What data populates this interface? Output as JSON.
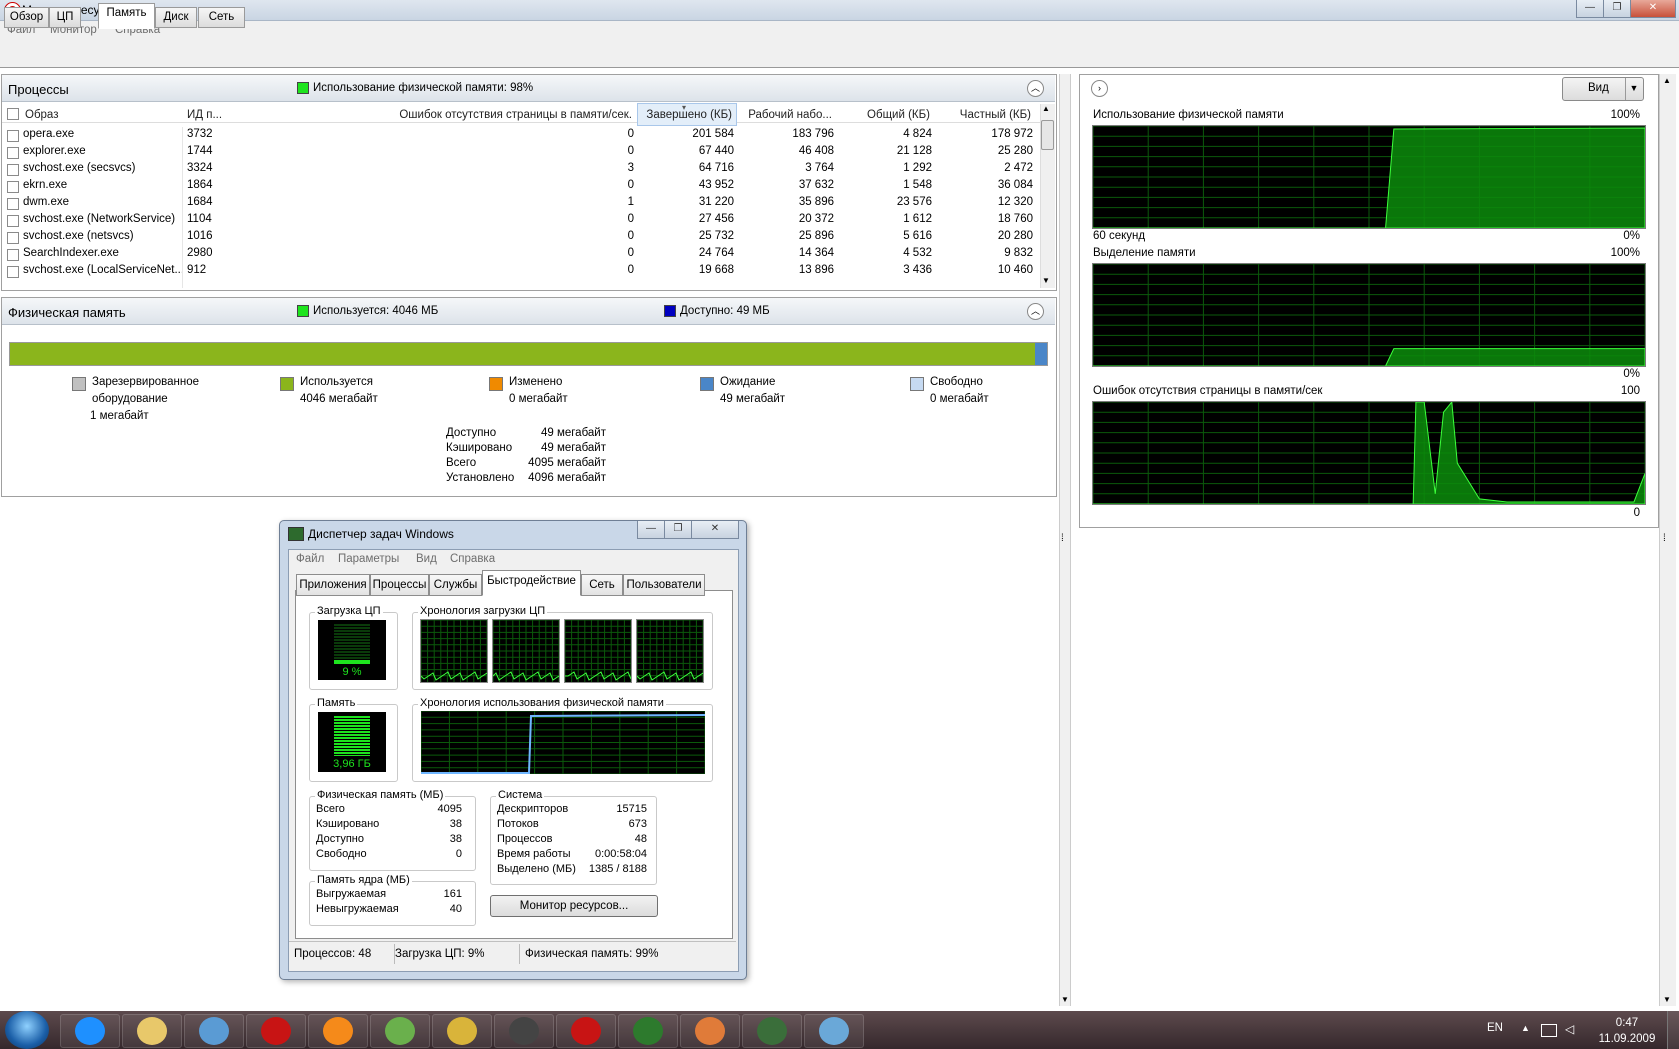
{
  "window": {
    "title": "Монитор ресурсов",
    "icon": "opera-icon"
  },
  "menu": [
    "Файл",
    "Монитор",
    "Справка"
  ],
  "tabs": [
    {
      "label": "Обзор",
      "active": false
    },
    {
      "label": "ЦП",
      "active": false
    },
    {
      "label": "Память",
      "active": true
    },
    {
      "label": "Диск",
      "active": false
    },
    {
      "label": "Сеть",
      "active": false
    }
  ],
  "processes": {
    "title": "Процессы",
    "legend": "Использование физической памяти: 98%",
    "legend_color": "#1ee41e",
    "columns": [
      "Образ",
      "ИД п...",
      "Ошибок отсутствия страницы в памяти/сек.",
      "Завершено (КБ)",
      "Рабочий набо...",
      "Общий (КБ)",
      "Частный (КБ)"
    ],
    "rows": [
      [
        "opera.exe",
        "3732",
        "0",
        "201 584",
        "183 796",
        "4 824",
        "178 972"
      ],
      [
        "explorer.exe",
        "1744",
        "0",
        "67 440",
        "46 408",
        "21 128",
        "25 280"
      ],
      [
        "svchost.exe (secsvcs)",
        "3324",
        "3",
        "64 716",
        "3 764",
        "1 292",
        "2 472"
      ],
      [
        "ekrn.exe",
        "1864",
        "0",
        "43 952",
        "37 632",
        "1 548",
        "36 084"
      ],
      [
        "dwm.exe",
        "1684",
        "1",
        "31 220",
        "35 896",
        "23 576",
        "12 320"
      ],
      [
        "svchost.exe (NetworkService)",
        "1104",
        "0",
        "27 456",
        "20 372",
        "1 612",
        "18 760"
      ],
      [
        "svchost.exe (netsvcs)",
        "1016",
        "0",
        "25 732",
        "25 896",
        "5 616",
        "20 280"
      ],
      [
        "SearchIndexer.exe",
        "2980",
        "0",
        "24 764",
        "14 364",
        "4 532",
        "9 832"
      ],
      [
        "svchost.exe (LocalServiceNet...",
        "912",
        "0",
        "19 668",
        "13 896",
        "3 436",
        "10 460"
      ]
    ]
  },
  "physical": {
    "title": "Физическая память",
    "used_legend": "Используется: 4046 МБ",
    "used_color": "#1ee41e",
    "avail_legend": "Доступно: 49 МБ",
    "avail_color": "#0000c0",
    "bar_used_fraction": 0.988,
    "bar_colors": {
      "used": "#8bb51c",
      "standby": "#4a86c8"
    },
    "categories": [
      {
        "name": "Зарезервированное оборудование",
        "line1": "Зарезервированное",
        "line2": "оборудование",
        "value": "1 мегабайт",
        "color": "#c0c0c0"
      },
      {
        "name": "Используется",
        "line1": "Используется",
        "line2": "",
        "value": "4046 мегабайт",
        "color": "#8bb51c"
      },
      {
        "name": "Изменено",
        "line1": "Изменено",
        "line2": "",
        "value": "0 мегабайт",
        "color": "#f08a00"
      },
      {
        "name": "Ожидание",
        "line1": "Ожидание",
        "line2": "",
        "value": "49 мегабайт",
        "color": "#4a86c8"
      },
      {
        "name": "Свободно",
        "line1": "Свободно",
        "line2": "",
        "value": "0 мегабайт",
        "color": "#c6daf2"
      }
    ],
    "summary": [
      {
        "label": "Доступно",
        "value": "49 мегабайт"
      },
      {
        "label": "Кэшировано",
        "value": "49 мегабайт"
      },
      {
        "label": "Всего",
        "value": "4095 мегабайт"
      },
      {
        "label": "Установлено",
        "value": "4096 мегабайт"
      }
    ]
  },
  "side": {
    "view_button": "Вид",
    "graph1": {
      "title": "Использование физической памяти",
      "max": "100%",
      "xlabel": "60 секунд",
      "min": "0%"
    },
    "graph2": {
      "title": "Выделение памяти",
      "max": "100%",
      "min": "0%"
    },
    "graph3": {
      "title": "Ошибок отсутствия страницы в памяти/сек",
      "max": "100",
      "min": "0"
    }
  },
  "taskmgr": {
    "title": "Диспетчер задач Windows",
    "menu": [
      "Файл",
      "Параметры",
      "Вид",
      "Справка"
    ],
    "tabs": [
      {
        "label": "Приложения",
        "active": false
      },
      {
        "label": "Процессы",
        "active": false
      },
      {
        "label": "Службы",
        "active": false
      },
      {
        "label": "Быстродействие",
        "active": true
      },
      {
        "label": "Сеть",
        "active": false
      },
      {
        "label": "Пользователи",
        "active": false
      }
    ],
    "cpu_label": "Загрузка ЦП",
    "cpu_value": "9 %",
    "cpu_history_label": "Хронология загрузки ЦП",
    "mem_label": "Память",
    "mem_value": "3,96 ГБ",
    "mem_history_label": "Хронология использования физической памяти",
    "phys_group": "Физическая память (МБ)",
    "phys_rows": [
      {
        "label": "Всего",
        "value": "4095"
      },
      {
        "label": "Кэшировано",
        "value": "38"
      },
      {
        "label": "Доступно",
        "value": "38"
      },
      {
        "label": "Свободно",
        "value": "0"
      }
    ],
    "kernel_group": "Память ядра (МБ)",
    "kernel_rows": [
      {
        "label": "Выгружаемая",
        "value": "161"
      },
      {
        "label": "Невыгружаемая",
        "value": "40"
      }
    ],
    "system_group": "Система",
    "system_rows": [
      {
        "label": "Дескрипторов",
        "value": "15715"
      },
      {
        "label": "Потоков",
        "value": "673"
      },
      {
        "label": "Процессов",
        "value": "48"
      },
      {
        "label": "Время работы",
        "value": "0:00:58:04"
      },
      {
        "label": "Выделено (МБ)",
        "value": "1385 / 8188"
      }
    ],
    "resmon_button": "Монитор ресурсов...",
    "status": [
      "Процессов: 48",
      "Загрузка ЦП: 9%",
      "Физическая память: 99%"
    ]
  },
  "taskbar": {
    "icons": [
      "start-orb-icon",
      "internet-explorer-icon",
      "explorer-folder-icon",
      "media-player-icon",
      "opera-icon",
      "orange-app-icon",
      "drink-app-icon",
      "robot-app-icon",
      "x3-app-icon",
      "red-app-icon",
      "stalker-app-icon",
      "butterfly-app-icon",
      "task-manager-icon",
      "resource-monitor-icon"
    ],
    "lang": "EN",
    "time": "0:47",
    "date": "11.09.2009"
  }
}
